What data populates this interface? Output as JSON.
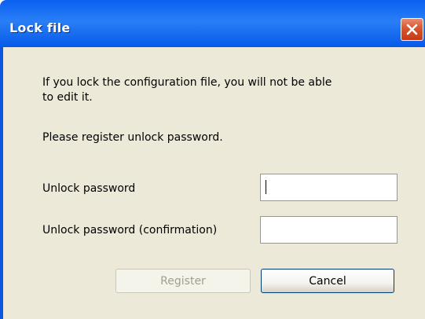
{
  "window": {
    "title": "Lock file",
    "close_icon": "close-x-icon"
  },
  "message": {
    "line1": "If you lock the configuration file, you will not be able",
    "line2": "to edit it.",
    "line3": "Please register unlock password."
  },
  "form": {
    "password_label": "Unlock password",
    "password_value": "",
    "confirmation_label": "Unlock password (confirmation)",
    "confirmation_value": ""
  },
  "buttons": {
    "register_label": "Register",
    "register_enabled": false,
    "cancel_label": "Cancel"
  },
  "colors": {
    "titlebar": "#0a5ff0",
    "client_background": "#ece9d8",
    "close_button": "#d9542f",
    "disabled_text": "#a19f8f"
  }
}
